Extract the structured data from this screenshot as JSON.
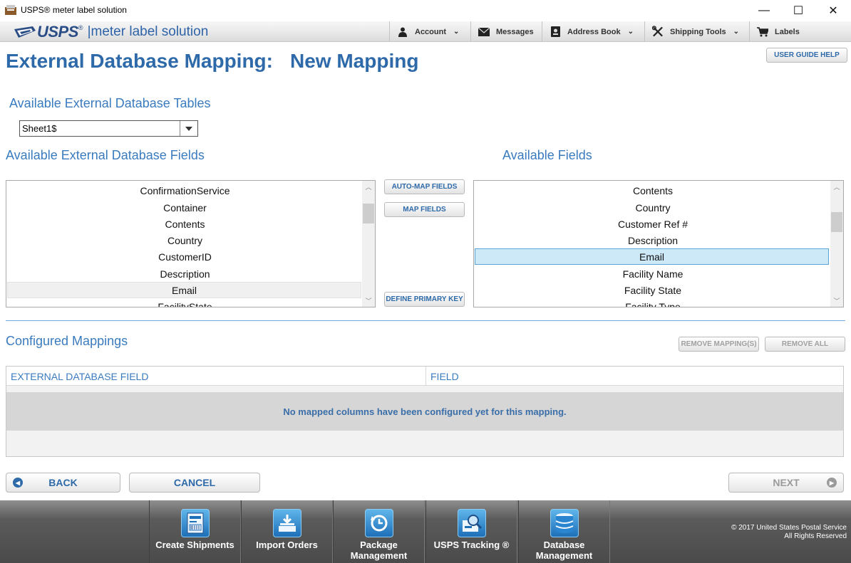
{
  "window": {
    "title": "USPS® meter label solution",
    "minimize": "—",
    "maximize": "☐",
    "close": "✕"
  },
  "brand": {
    "name": "USPS",
    "reg": "®",
    "subtitle": "|meter label solution"
  },
  "nav": {
    "account": "Account",
    "messages": "Messages",
    "address_book": "Address Book",
    "shipping_tools": "Shipping Tools",
    "labels": "Labels",
    "chevron": "⌄"
  },
  "page": {
    "title_part1": "External Database Mapping:",
    "title_part2": "New Mapping",
    "user_guide_help": "USER GUIDE HELP"
  },
  "tables_section": {
    "label": "Available External Database Tables",
    "selected": "Sheet1$"
  },
  "ext_fields": {
    "label": "Available External Database Fields",
    "items": [
      "ConfirmationService",
      "Container",
      "Contents",
      "Country",
      "CustomerID",
      "Description",
      "Email",
      "FacilityState"
    ],
    "selected": "Email"
  },
  "actions": {
    "auto_map": "AUTO-MAP FIELDS",
    "map": "MAP FIELDS",
    "define_primary_key": "DEFINE PRIMARY KEY"
  },
  "avail_fields": {
    "label": "Available Fields",
    "items": [
      "Contents",
      "Country",
      "Customer Ref #",
      "Description",
      "Email",
      "Facility Name",
      "Facility State",
      "Facility Type"
    ],
    "selected": "Email"
  },
  "mappings": {
    "label": "Configured Mappings",
    "remove_mappings": "REMOVE MAPPING(S)",
    "remove_all": "REMOVE ALL",
    "columns": [
      "EXTERNAL DATABASE FIELD",
      "FIELD"
    ],
    "empty_message": "No mapped columns have been configured yet for this mapping."
  },
  "buttons": {
    "back": "BACK",
    "cancel": "CANCEL",
    "next": "NEXT"
  },
  "footer": {
    "tiles": [
      {
        "label": "Create Shipments"
      },
      {
        "label": "Import Orders"
      },
      {
        "label": "Package\nManagement"
      },
      {
        "label": "USPS Tracking ®"
      },
      {
        "label": "Database\nManagement"
      }
    ],
    "copyright_line1": "© 2017 United States Postal Service",
    "copyright_line2": "All Rights Reserved"
  },
  "colors": {
    "accent": "#2e6aa9",
    "section": "#3a7bbf",
    "selection": "#cde8f7"
  }
}
